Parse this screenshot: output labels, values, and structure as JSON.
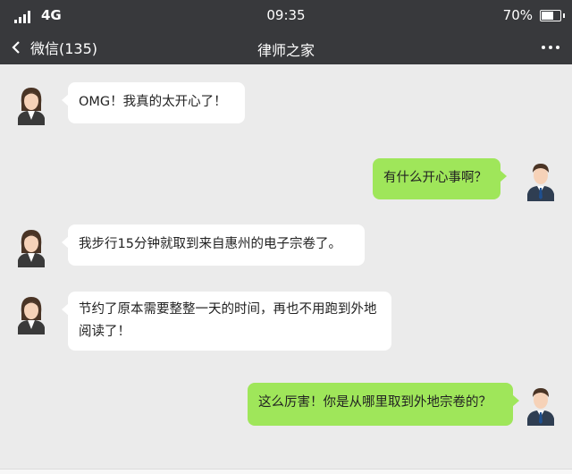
{
  "status_bar": {
    "network": "4G",
    "time": "09:35",
    "battery": "70%",
    "battery_level": 0.7
  },
  "nav": {
    "back_label": "微信(135)",
    "title": "律师之家",
    "more_icon": "more-dots-icon"
  },
  "messages": [
    {
      "side": "left",
      "avatar": "female-avatar",
      "text": "OMG！我真的太开心了！"
    },
    {
      "side": "right",
      "avatar": "male-avatar",
      "text": "有什么开心事啊？"
    },
    {
      "side": "left",
      "avatar": "female-avatar",
      "text": "我步行15分钟就取到来自惠州的电子宗卷了。"
    },
    {
      "side": "left",
      "avatar": "female-avatar",
      "text": "节约了原本需要整整一天的时间，再也不用跑到外地阅读了！"
    },
    {
      "side": "right",
      "avatar": "male-avatar",
      "text": "这么厉害！你是从哪里取到外地宗卷的？"
    }
  ],
  "colors": {
    "header_bg": "#38393c",
    "chat_bg": "#ebebeb",
    "incoming_bubble": "#ffffff",
    "outgoing_bubble": "#9fe65a"
  }
}
